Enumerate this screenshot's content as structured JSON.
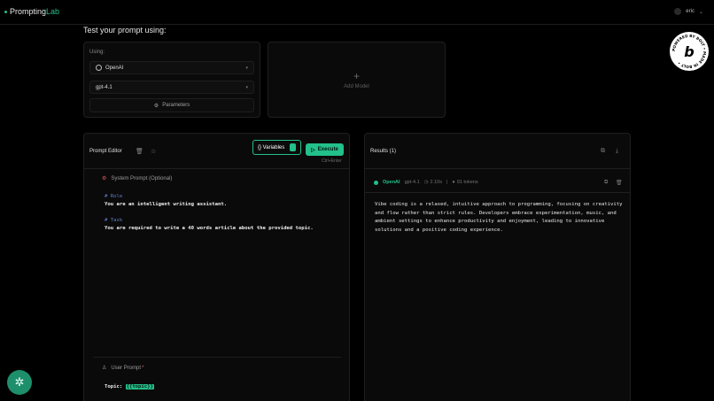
{
  "app": {
    "name_part1": "Prompting",
    "name_part2": "Lab",
    "user": "eric"
  },
  "badge": {
    "text": "POWERED BY BOLT • MADE IN BOLT • ",
    "letter": "b"
  },
  "heading": "Test your prompt using:",
  "using": {
    "label": "Using:",
    "provider": "OpenAI",
    "model": "gpt-4.1",
    "parameters_label": "Parameters"
  },
  "add_model": {
    "label": "Add Model"
  },
  "editor": {
    "title": "Prompt Editor",
    "variables_label": "{} Variables",
    "execute_label": "Execute",
    "shortcut": "Ctrl+Enter",
    "system_label": "System Prompt (Optional)",
    "system_lines": [
      {
        "type": "comment",
        "text": "# Role"
      },
      {
        "type": "text",
        "text": "You are an intelligent writing assistant."
      },
      {
        "type": "blank",
        "text": ""
      },
      {
        "type": "comment",
        "text": "# Task"
      },
      {
        "type": "text",
        "text": "You are required to write a 40 words article about the provided topic."
      }
    ],
    "user_label": "User Prompt",
    "user_required": "*",
    "user_prefix": "Topic: ",
    "user_variable": "{{topic}}"
  },
  "results": {
    "title": "Results (1)",
    "provider": "OpenAI",
    "model": "gpt-4.1",
    "time": "2.10s",
    "tokens": "91 tokens",
    "separator": "|",
    "output": "Vibe coding is a relaxed, intuitive approach to programming, focusing on creativity and flow rather than strict rules. Developers embrace experimentation, music, and ambient settings to enhance productivity and enjoyment, leading to innovative solutions and a positive coding experience."
  },
  "colors": {
    "accent": "#22c08a",
    "background": "#000000",
    "card": "#0a0a0a"
  }
}
